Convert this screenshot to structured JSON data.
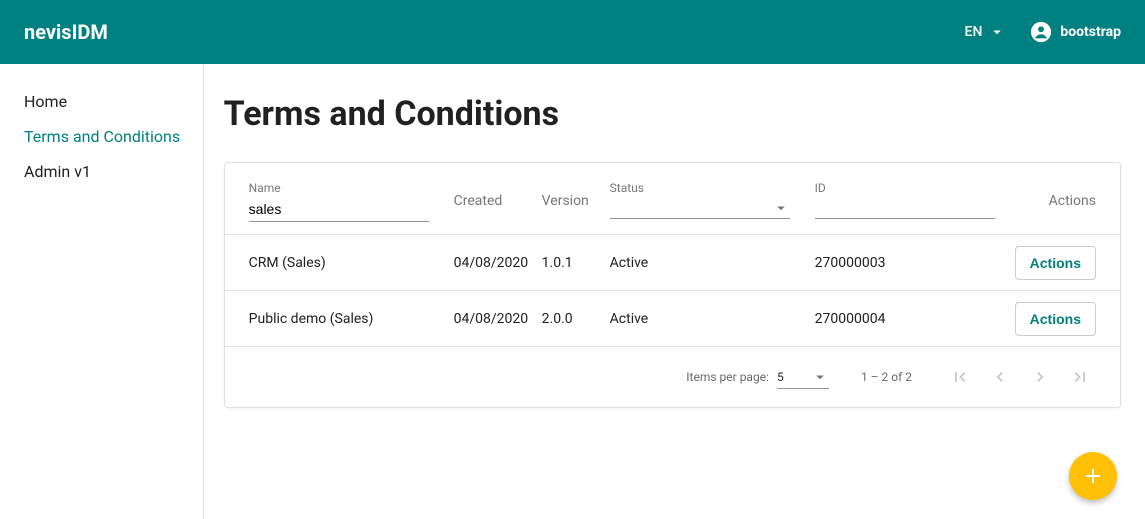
{
  "colors": {
    "primary": "#008080",
    "accent": "#ffc107"
  },
  "header": {
    "brand": "nevisIDM",
    "language": "EN",
    "user": "bootstrap"
  },
  "sidebar": {
    "items": [
      {
        "label": "Home",
        "active": false
      },
      {
        "label": "Terms and Conditions",
        "active": true
      },
      {
        "label": "Admin v1",
        "active": false
      }
    ]
  },
  "page": {
    "title": "Terms and Conditions"
  },
  "table": {
    "columns": {
      "name": "Name",
      "created": "Created",
      "version": "Version",
      "status": "Status",
      "id": "ID",
      "actions": "Actions"
    },
    "filters": {
      "name_value": "sales",
      "status_value": "",
      "id_value": ""
    },
    "rows": [
      {
        "name": "CRM (Sales)",
        "created": "04/08/2020",
        "version": "1.0.1",
        "status": "Active",
        "id": "270000003",
        "actions_label": "Actions"
      },
      {
        "name": "Public demo (Sales)",
        "created": "04/08/2020",
        "version": "2.0.0",
        "status": "Active",
        "id": "270000004",
        "actions_label": "Actions"
      }
    ]
  },
  "paginator": {
    "items_per_page_label": "Items per page:",
    "page_size": "5",
    "range_label": "1 – 2 of 2"
  }
}
